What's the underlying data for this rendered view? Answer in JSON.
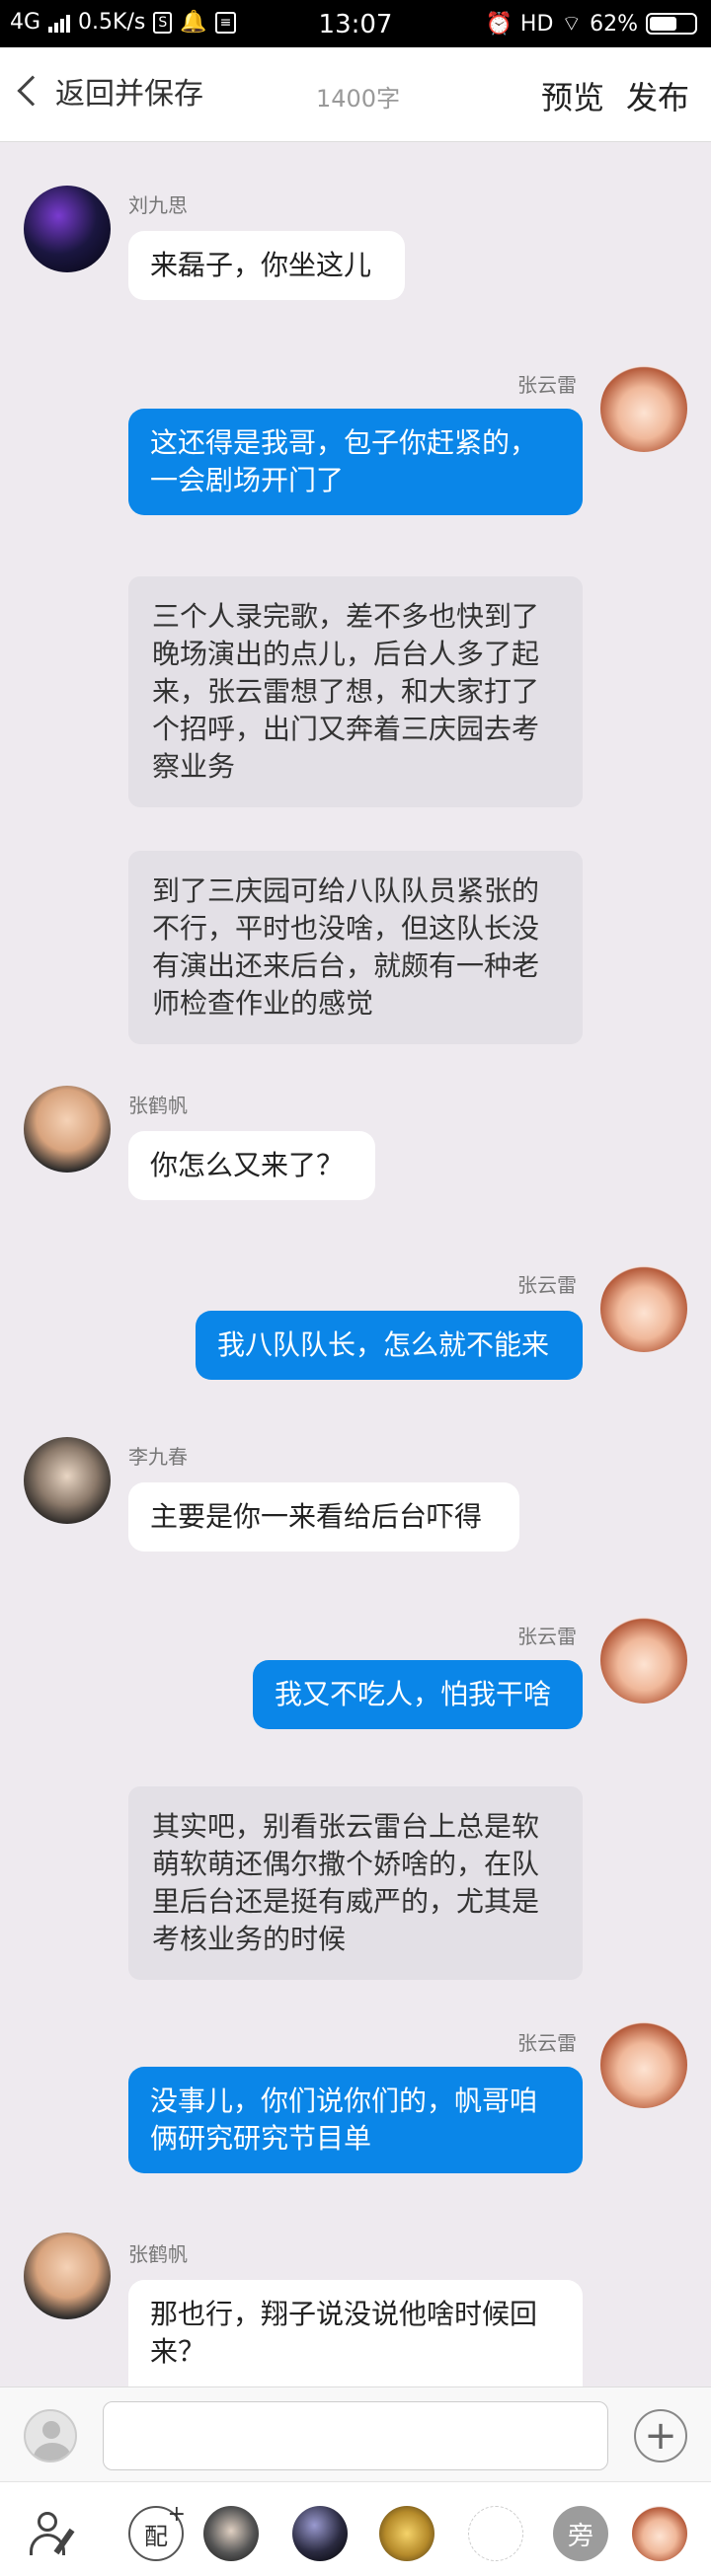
{
  "status_bar": {
    "network": "4G",
    "speed": "0.5K/s",
    "time": "13:07",
    "hd": "HD",
    "battery": "62%",
    "battery_level": 0.62
  },
  "nav": {
    "back_label": "返回并保存",
    "word_count": "1400字",
    "preview_label": "预览",
    "publish_label": "发布"
  },
  "chat": {
    "m1_name": "刘九思",
    "m1_text": "来磊子，你坐这儿",
    "m2_name": "张云雷",
    "m2_text": "这还得是我哥，包子你赶紧的，\n一会剧场开门了",
    "n1_text": "三个人录完歌，差不多也快到了\n晚场演出的点儿，后台人多了起\n来，张云雷想了想，和大家打了\n个招呼，出门又奔着三庆园去考\n察业务",
    "n2_text": "到了三庆园可给八队队员紧张的\n不行，平时也没啥，但这队长没\n有演出还来后台，就颇有一种老\n师检查作业的感觉",
    "m3_name": "张鹤帆",
    "m3_text": "你怎么又来了？",
    "m4_name": "张云雷",
    "m4_text": "我八队队长，怎么就不能来",
    "m5_name": "李九春",
    "m5_text": "主要是你一来看给后台吓得",
    "m6_name": "张云雷",
    "m6_text": "我又不吃人，怕我干啥",
    "n3_text": "其实吧，别看张云雷台上总是软\n萌软萌还偶尔撒个娇啥的，在队\n里后台还是挺有威严的，尤其是\n考核业务的时候",
    "m7_name": "张云雷",
    "m7_text": "没事儿，你们说你们的，帆哥咱\n俩研究研究节目单",
    "m8_name": "张鹤帆",
    "m8_text": "那也行，翔子说没说他啥时候回\n来？"
  },
  "input": {
    "placeholder": ""
  },
  "role_bar": {
    "pei_label": "配",
    "pang_label": "旁"
  }
}
